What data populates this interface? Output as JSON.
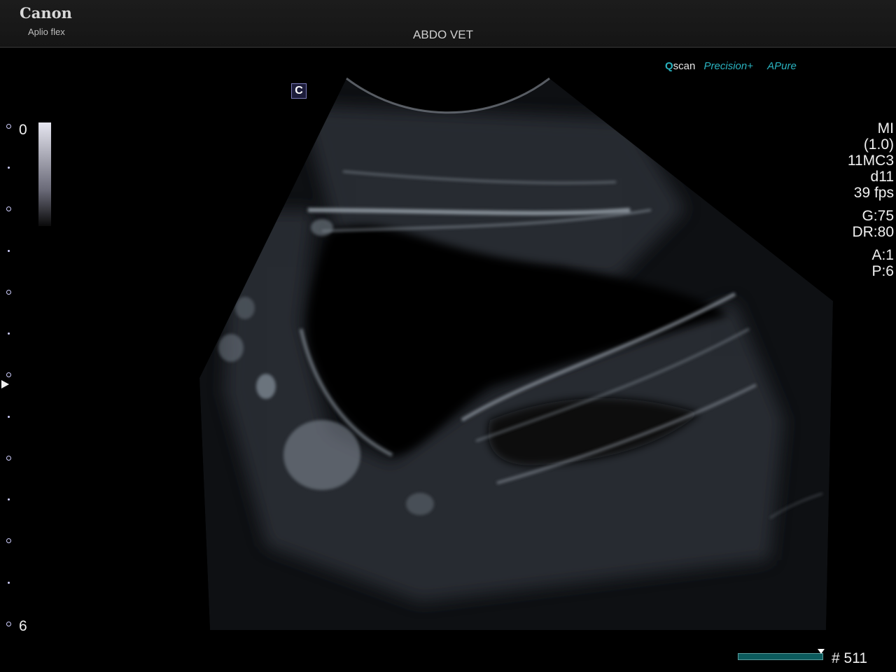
{
  "header": {
    "brand": "Canon",
    "model": "Aplio flex",
    "preset": "ABDO VET"
  },
  "marker": "C",
  "features": {
    "qscan_q": "Q",
    "qscan_rest": "scan",
    "precision": "Precision+",
    "apure_a": "A",
    "apure_rest": "Pure"
  },
  "params": {
    "mi": "MI",
    "mi_value": "(1.0)",
    "probe": "11MC3",
    "depth_preset": "d11",
    "frame_rate": "39 fps",
    "gain": "G:75",
    "dynamic_range": "DR:80",
    "a": "A:1",
    "p": "P:6"
  },
  "grayscale": {
    "top": "0",
    "bottom": "6"
  },
  "cine": {
    "frame": "# 511"
  },
  "colors": {
    "accent": "#2ab3c0",
    "cine_bar": "#0c5b5d",
    "scale_ticks": "#cfcfff"
  },
  "icons": {
    "focus": "focus-triangle-icon"
  }
}
